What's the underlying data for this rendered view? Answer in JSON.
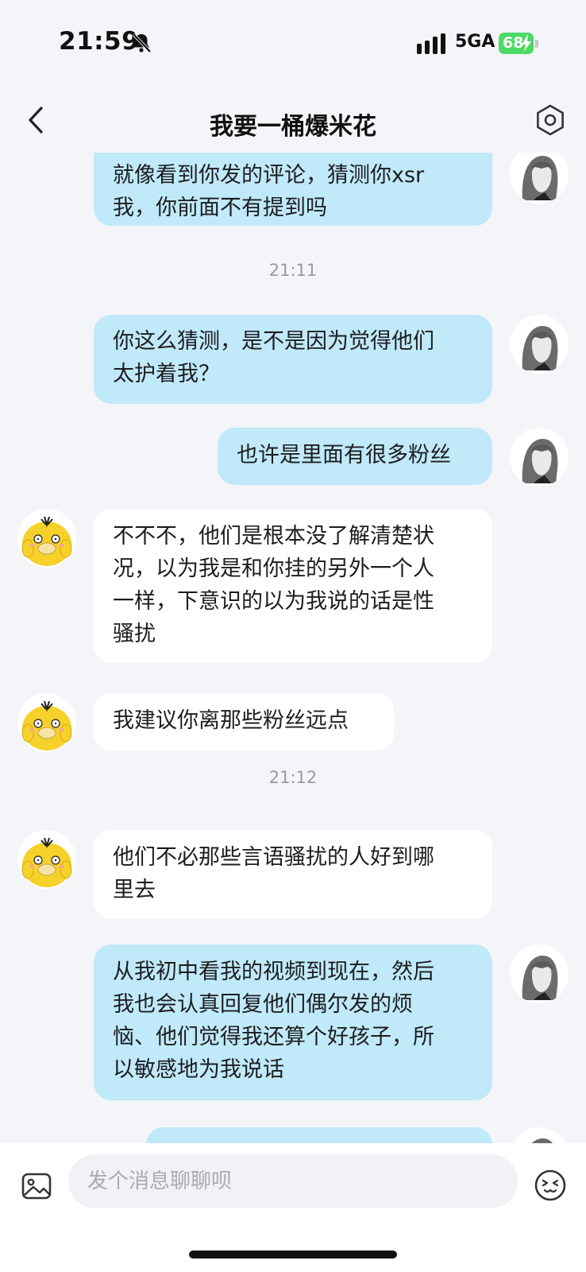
{
  "status_bar": {
    "time": "21:59",
    "network": "5GA",
    "battery": "68"
  },
  "header": {
    "title": "我要一桶爆米花"
  },
  "messages": [
    {
      "type": "out",
      "lines": [
        "就像看到你发的评论，猜测你xsr",
        "我，你前面不有提到吗"
      ]
    },
    {
      "type": "time",
      "text": "21:11"
    },
    {
      "type": "out",
      "lines": [
        "你这么猜测，是不是因为觉得他们",
        "太护着我？"
      ]
    },
    {
      "type": "out",
      "lines": [
        "也许是里面有很多粉丝"
      ]
    },
    {
      "type": "in",
      "lines": [
        "不不不，他们是根本没了解清楚状",
        "况，以为我是和你挂的另外一个人",
        "一样，下意识的以为我说的话是性",
        "骚扰"
      ]
    },
    {
      "type": "in",
      "lines": [
        "我建议你离那些粉丝远点"
      ]
    },
    {
      "type": "time",
      "text": "21:12"
    },
    {
      "type": "in",
      "lines": [
        "他们不必那些言语骚扰的人好到哪",
        "里去"
      ]
    },
    {
      "type": "out",
      "lines": [
        "从我初中看我的视频到现在，然后",
        "我也会认真回复他们偶尔发的烦",
        "恼、他们觉得我还算个好孩子，所",
        "以敏感地为我说话"
      ]
    },
    {
      "type": "out",
      "lines": [
        ""
      ]
    }
  ],
  "input": {
    "placeholder": "发个消息聊聊呗"
  },
  "icons": {
    "back": "back-icon",
    "settings": "settings-icon",
    "image": "image-icon",
    "emoji": "emoji-icon",
    "bell_muted": "bell-muted-icon",
    "signal": "signal-icon"
  },
  "colors": {
    "outgoing_bubble": "#c0e9f9",
    "incoming_bubble": "#ffffff",
    "background": "#f4f5f8",
    "battery": "#4cd964"
  }
}
